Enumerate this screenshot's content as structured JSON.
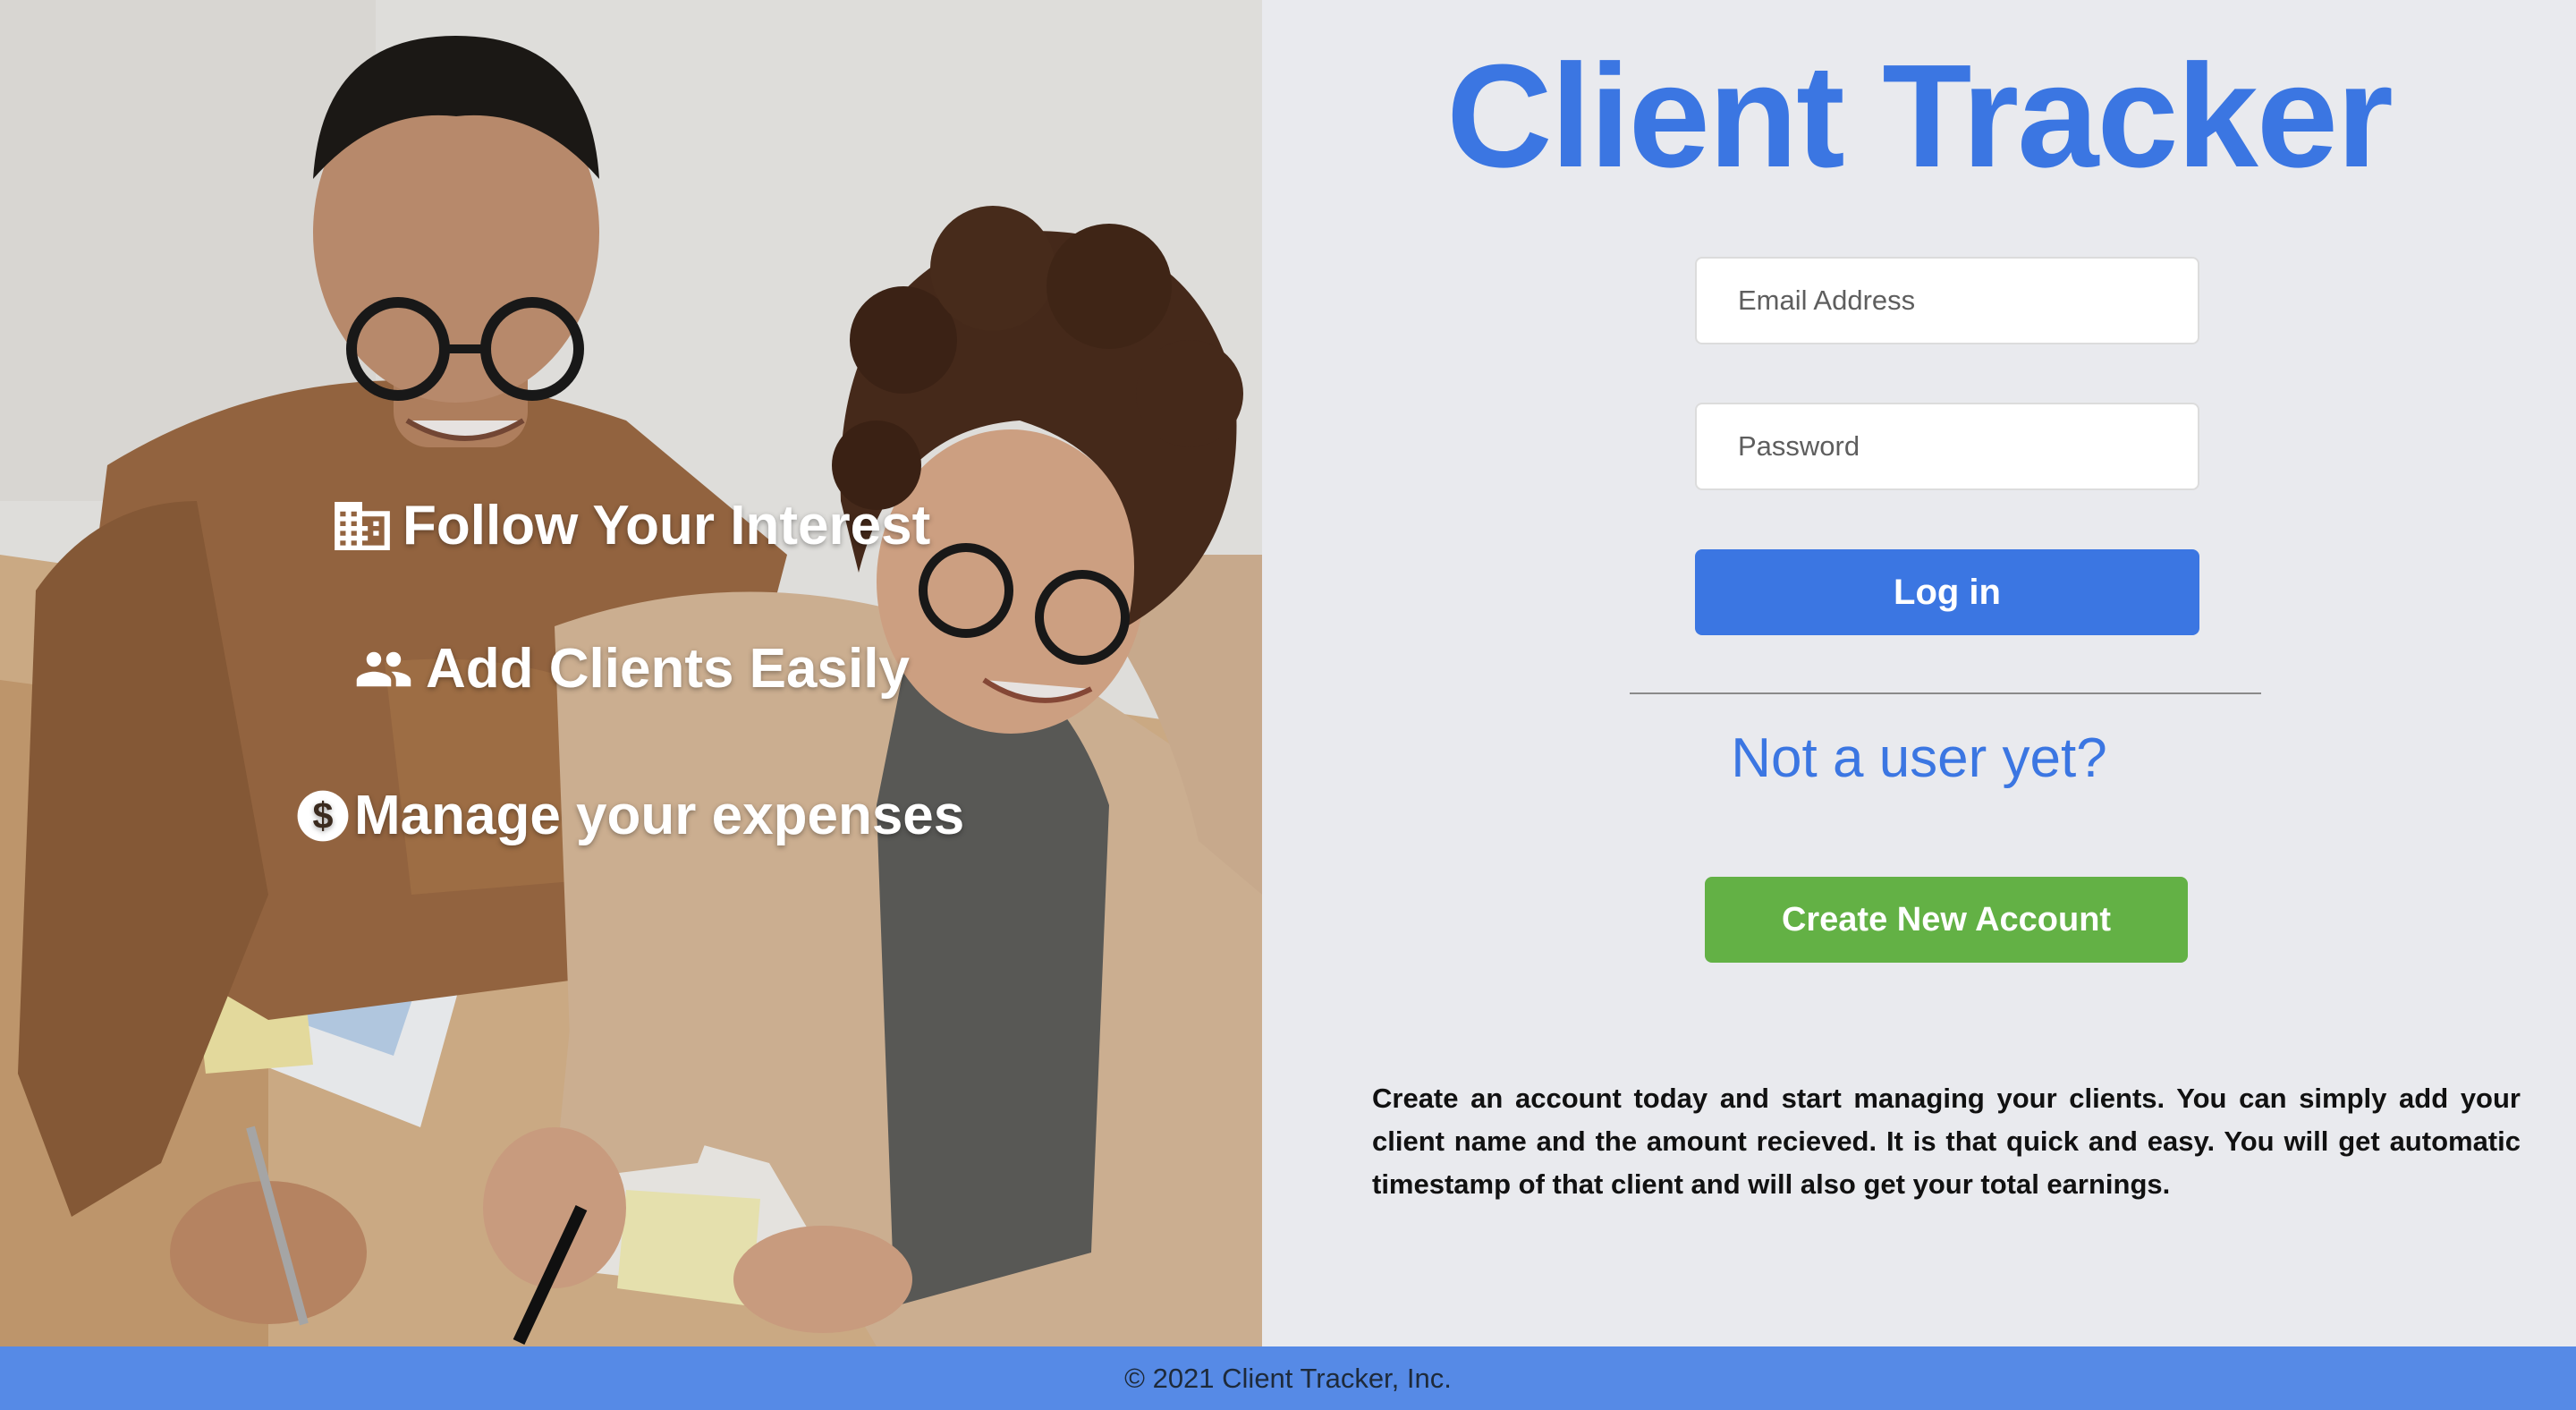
{
  "hero": {
    "features": [
      {
        "icon": "building-icon",
        "label": "Follow Your Interest"
      },
      {
        "icon": "people-icon",
        "label": "Add Clients Easily"
      },
      {
        "icon": "dollar-circle-icon",
        "label": "Manage your expenses"
      }
    ]
  },
  "login": {
    "title": "Client Tracker",
    "email_placeholder": "Email Address",
    "password_placeholder": "Password",
    "login_label": "Log in",
    "signup_prompt": "Not a user yet?",
    "create_account_label": "Create New Account",
    "description": "Create an account today and start managing your clients. You can simply add your client name and the amount recieved. It is that quick and easy. You will get automatic timestamp of that client and will also get your total earnings."
  },
  "footer": {
    "copyright": "© 2021 Client Tracker, Inc."
  },
  "colors": {
    "brand_blue": "#3b76e2",
    "success_green": "#63b145",
    "footer_blue": "#568ae6",
    "panel_bg": "#e9eaee"
  }
}
